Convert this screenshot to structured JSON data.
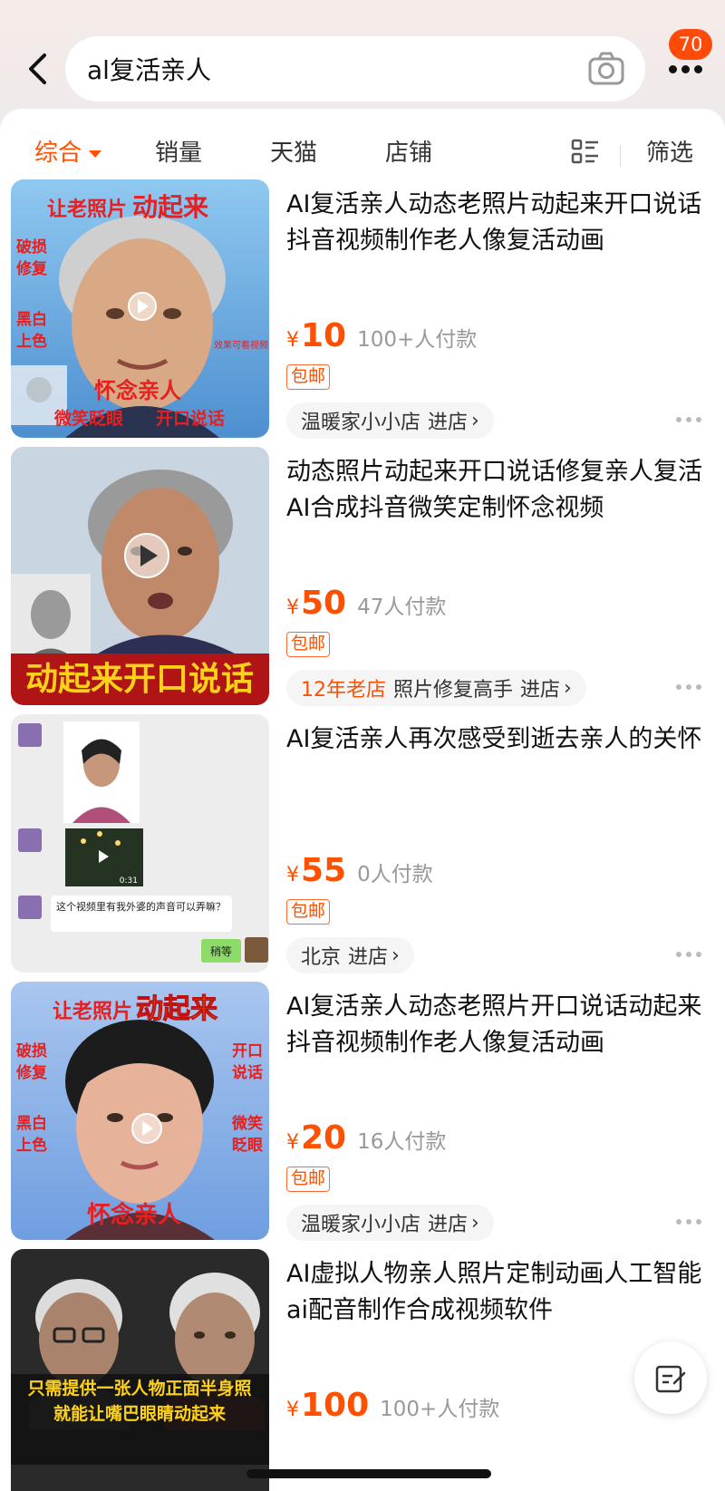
{
  "search": {
    "query": "al复活亲人"
  },
  "header": {
    "badge_count": "70"
  },
  "tabs": [
    {
      "label": "综合",
      "active": true
    },
    {
      "label": "销量"
    },
    {
      "label": "天猫"
    },
    {
      "label": "店铺"
    }
  ],
  "filter_label": "筛选",
  "products": [
    {
      "title": "AI复活亲人动态老照片动起来开口说话抖音视频制作老人像复活动画",
      "yen": "¥",
      "price": "10",
      "sold": "100+人付款",
      "ship": "包邮",
      "shop_age": "",
      "shop": "温暖家小小店",
      "enter": "进店",
      "thumb": {
        "top_text_1": "让老照片",
        "top_text_2": "动起来",
        "side_1": "破损",
        "side_2": "修复",
        "side_3": "黑白",
        "side_4": "上色",
        "note": "效果可看视频展示",
        "bottom_1": "怀念亲人",
        "bottom_2": "微笑眨眼",
        "bottom_3": "开口说话"
      }
    },
    {
      "title": "动态照片动起来开口说话修复亲人复活AI合成抖音微笑定制怀念视频",
      "yen": "¥",
      "price": "50",
      "sold": "47人付款",
      "ship": "包邮",
      "shop_age": "12年老店",
      "shop": "照片修复高手",
      "enter": "进店",
      "thumb": {
        "banner": "动起来开口说话"
      }
    },
    {
      "title": "AI复活亲人再次感受到逝去亲人的关怀",
      "yen": "¥",
      "price": "55",
      "sold": "0人付款",
      "ship": "包邮",
      "shop_age": "",
      "shop": "北京",
      "enter": "进店",
      "thumb": {
        "duration": "0:31",
        "chat": "这个视频里有我外婆的声音可以弄嘛？",
        "reply": "稍等"
      }
    },
    {
      "title": "AI复活亲人动态老照片开口说话动起来抖音视频制作老人像复活动画",
      "yen": "¥",
      "price": "20",
      "sold": "16人付款",
      "ship": "包邮",
      "shop_age": "",
      "shop": "温暖家小小店",
      "enter": "进店",
      "thumb": {
        "top_text_1": "让老照片",
        "top_text_2": "动起来",
        "side_1": "破损",
        "side_2": "修复",
        "side_3": "黑白",
        "side_4": "上色",
        "side_5": "开口",
        "side_6": "说话",
        "side_7": "微笑",
        "side_8": "眨眼",
        "bottom_1": "怀念亲人"
      }
    },
    {
      "title": "AI虚拟人物亲人照片定制动画人工智能ai配音制作合成视频软件",
      "yen": "¥",
      "price": "100",
      "sold": "100+人付款",
      "thumb": {
        "caption_1": "只需提供一张人物正面半身照",
        "caption_2": "就能让嘴巴眼睛动起来"
      }
    }
  ],
  "colors": {
    "accent": "#ff5000",
    "badge": "#ff4a0a"
  }
}
